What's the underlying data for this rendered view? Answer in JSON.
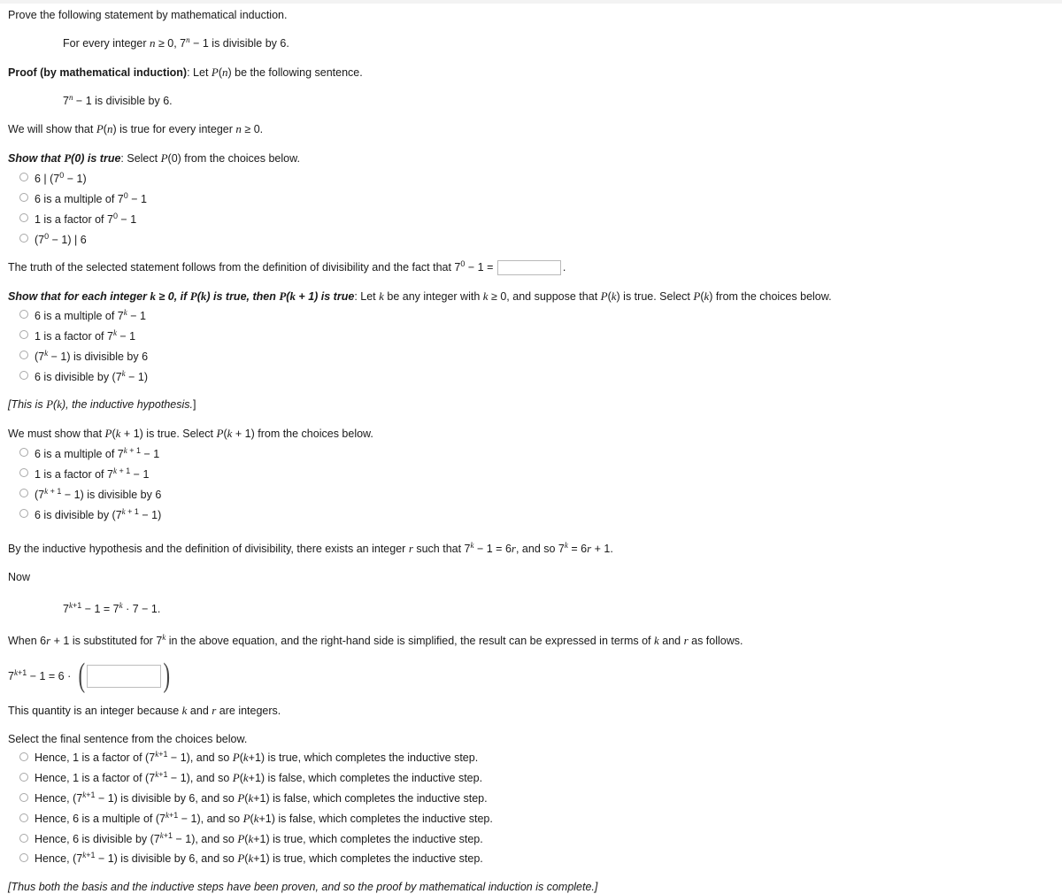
{
  "prompt": "Prove the following statement by mathematical induction.",
  "statement": {
    "prefix": "For every integer ",
    "n": "n",
    "mid": " ≥ 0, 7",
    "exp": "n",
    "suffix": " − 1 is divisible by 6."
  },
  "proof_header": {
    "bold": "Proof (by mathematical induction)",
    "rest_pre": ": Let ",
    "pn": "P",
    "paren_n": "(n)",
    "rest_post": " be the following sentence."
  },
  "pn_sentence": {
    "base": "7",
    "exp": "n",
    "rest": " − 1 is divisible by 6."
  },
  "will_show": {
    "pre": "We will show that ",
    "p": "P",
    "paren": "(n)",
    "mid": " is true for every integer ",
    "var": "n",
    "post": " ≥ 0."
  },
  "basis": {
    "bold_italic": "Show that P(0) is true",
    "rest": ": Select P(0) from the choices below.",
    "rest_pre": ": Select ",
    "rest_p": "P",
    "rest_paren": "(0)",
    "rest_post": " from the choices below.",
    "choices": [
      {
        "id": "p0-choice-1",
        "html": "6 | (7<sup>0</sup> − 1)",
        "text": "6 | (7^0 − 1)"
      },
      {
        "id": "p0-choice-2",
        "html": "6 is a multiple of 7<sup>0</sup> − 1",
        "text": "6 is a multiple of 7^0 − 1"
      },
      {
        "id": "p0-choice-3",
        "html": "1 is a factor of 7<sup>0</sup> − 1",
        "text": "1 is a factor of 7^0 − 1"
      },
      {
        "id": "p0-choice-4",
        "html": "(7<sup>0</sup> − 1) | 6",
        "text": "(7^0 − 1) | 6"
      }
    ]
  },
  "truth_line": {
    "pre": "The truth of the selected statement follows from the definition of divisibility and the fact that 7",
    "exp": "0",
    "mid": " − 1 = ",
    "input_value": "",
    "post": "."
  },
  "inductive": {
    "bold_italic": "Show that for each integer k ≥ 0, if P(k) is true, then P(k + 1) is true",
    "rest": ": Let k be any integer with k ≥ 0, and suppose that P(k) is true. Select P(k) from the choices below.",
    "choices": [
      {
        "id": "pk-choice-1",
        "html": "6 is a multiple of 7<sup><i>k</i></sup> − 1",
        "text": "6 is a multiple of 7^k − 1"
      },
      {
        "id": "pk-choice-2",
        "html": "1 is a factor of 7<sup><i>k</i></sup> − 1",
        "text": "1 is a factor of 7^k − 1"
      },
      {
        "id": "pk-choice-3",
        "html": "(7<sup><i>k</i></sup> − 1) is divisible by 6",
        "text": "(7^k − 1) is divisible by 6"
      },
      {
        "id": "pk-choice-4",
        "html": "6 is divisible by (7<sup><i>k</i></sup> − 1)",
        "text": "6 is divisible by (7^k − 1)"
      }
    ]
  },
  "hypothesis_note": "[This is P(k), the inductive hypothesis.]",
  "must_show": "We must show that P(k + 1) is true. Select P(k + 1) from the choices below.",
  "inductive_step": {
    "choices": [
      {
        "id": "pk1-choice-1",
        "html": "6 is a multiple of 7<sup><i>k</i> + 1</sup> − 1",
        "text": "6 is a multiple of 7^(k + 1) − 1"
      },
      {
        "id": "pk1-choice-2",
        "html": "1 is a factor of 7<sup><i>k</i> + 1</sup> − 1",
        "text": "1 is a factor of 7^(k + 1) − 1"
      },
      {
        "id": "pk1-choice-3",
        "html": "(7<sup><i>k</i> + 1</sup> − 1) is divisible by 6",
        "text": "(7^(k + 1) − 1) is divisible by 6"
      },
      {
        "id": "pk1-choice-4",
        "html": "6 is divisible by (7<sup><i>k</i> + 1</sup> − 1)",
        "text": "6 is divisible by (7^(k + 1) − 1)"
      }
    ]
  },
  "by_hypothesis": "By the inductive hypothesis and the definition of divisibility, there exists an integer r such that 7^k − 1 = 6r, and so 7^k = 6r + 1.",
  "now_label": "Now",
  "displayed_equation": "7^(k+1) − 1 = 7^k · 7 − 1.",
  "substitution_line": "When 6r + 1 is substituted for 7^k in the above equation, and the right-hand side is simplified, the result can be expressed in terms of k and r as follows.",
  "result_equation": {
    "lhs": "7^(k+1) − 1 = 6 ·",
    "open_paren": "(",
    "input_value": "",
    "close_paren": ")"
  },
  "integer_note": "This quantity is an integer because k and r are integers.",
  "final_prompt": "Select the final sentence from the choices below.",
  "final_choices": [
    {
      "id": "final-choice-1",
      "html": "Hence, 1 is a factor of (7<sup><i>k</i>+1</sup> − 1), and so <i>P</i>(<i>k</i>+1) is true, which completes the inductive step.",
      "text": "Hence, 1 is a factor of (7^(k+1) − 1), and so P(k+1) is true, which completes the inductive step."
    },
    {
      "id": "final-choice-2",
      "html": "Hence, 1 is a factor of (7<sup><i>k</i>+1</sup> − 1), and so <i>P</i>(<i>k</i>+1) is false, which completes the inductive step.",
      "text": "Hence, 1 is a factor of (7^(k+1) − 1), and so P(k+1) is false, which completes the inductive step."
    },
    {
      "id": "final-choice-3",
      "html": "Hence, (7<sup><i>k</i>+1</sup> − 1) is divisible by 6, and so <i>P</i>(<i>k</i>+1) is false, which completes the inductive step.",
      "text": "Hence, (7^(k+1) − 1) is divisible by 6, and so P(k+1) is false, which completes the inductive step."
    },
    {
      "id": "final-choice-4",
      "html": "Hence, 6 is a multiple of (7<sup><i>k</i>+1</sup> − 1), and so <i>P</i>(<i>k</i>+1) is false, which completes the inductive step.",
      "text": "Hence, 6 is a multiple of (7^(k+1) − 1), and so P(k+1) is false, which completes the inductive step."
    },
    {
      "id": "final-choice-5",
      "html": "Hence, 6 is divisible by (7<sup><i>k</i>+1</sup> − 1), and so <i>P</i>(<i>k</i>+1) is true, which completes the inductive step.",
      "text": "Hence, 6 is divisible by (7^(k+1) − 1), and so P(k+1) is true, which completes the inductive step."
    },
    {
      "id": "final-choice-6",
      "html": "Hence, (7<sup><i>k</i>+1</sup> − 1) is divisible by 6, and so <i>P</i>(<i>k</i>+1) is true, which completes the inductive step.",
      "text": "Hence, (7^(k+1) − 1) is divisible by 6, and so P(k+1) is true, which completes the inductive step."
    }
  ],
  "closing_note": "[Thus both the basis and the inductive steps have been proven, and so the proof by mathematical induction is complete.]"
}
